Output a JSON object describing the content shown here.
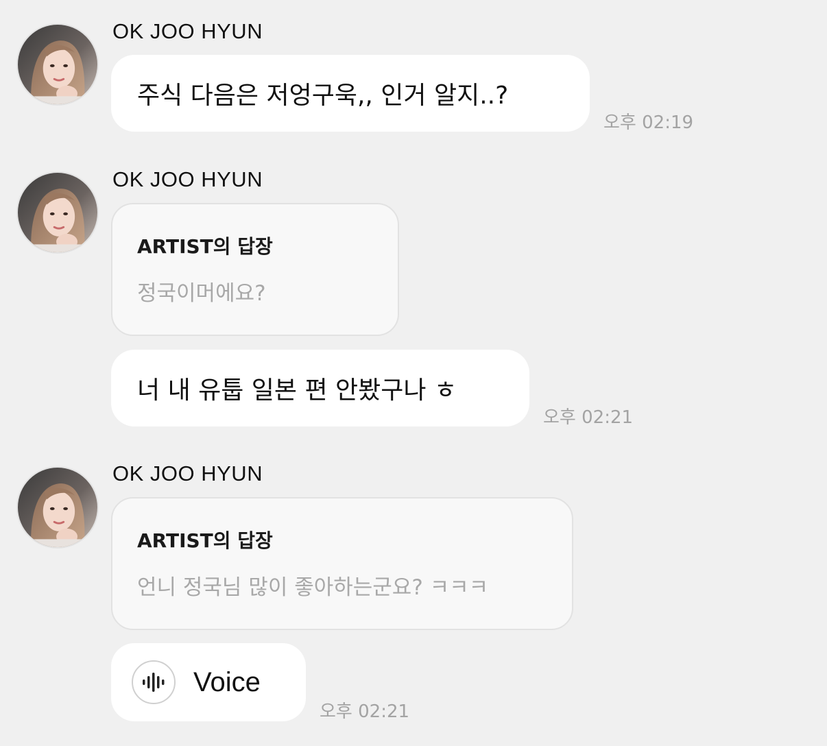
{
  "colors": {
    "background": "#f0f0f0",
    "bubble": "#ffffff",
    "reply_card": "#f8f8f8",
    "timestamp": "#a3a3a3",
    "quote_text": "#a8a8a8"
  },
  "messages": [
    {
      "sender": "OK JOO HYUN",
      "avatar_icon": "profile-photo",
      "text": "주식 다음은 저엉구욱,, 인거 알지..?",
      "time": "오후 02:19"
    },
    {
      "sender": "OK JOO HYUN",
      "avatar_icon": "profile-photo",
      "reply": {
        "title": "ARTIST의 답장",
        "quote": "정국이머에요?"
      },
      "text": "너 내 유툽 일본 편 안봤구나 ㅎ",
      "time": "오후 02:21"
    },
    {
      "sender": "OK JOO HYUN",
      "avatar_icon": "profile-photo",
      "reply": {
        "title": "ARTIST의 답장",
        "quote": "언니 정국님 많이 좋아하는군요? ㅋㅋㅋ"
      },
      "voice": {
        "icon": "sound-wave-icon",
        "label": "Voice"
      },
      "time": "오후 02:21"
    }
  ]
}
